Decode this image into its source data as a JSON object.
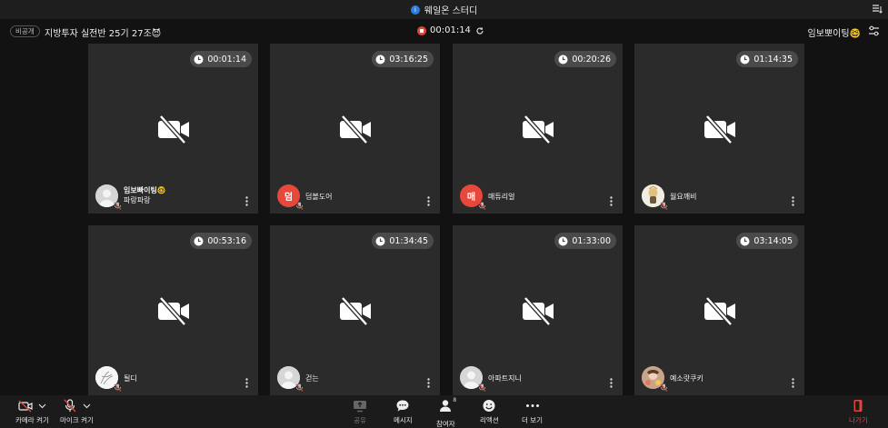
{
  "window": {
    "title": "웨일온 스터디"
  },
  "header": {
    "privacy": "비공개",
    "room_title": "지방투자 실전반 25기 27조😈",
    "elapsed": "00:01:14",
    "me": "임보뽀이팅🤓"
  },
  "participants": [
    {
      "time": "00:01:14",
      "name": "임보빠이팅🤓",
      "subname": "파랑파랑",
      "avatar": {
        "type": "gray",
        "text": ""
      }
    },
    {
      "time": "03:16:25",
      "name": "덤볼도어",
      "avatar": {
        "type": "red",
        "text": "덤"
      }
    },
    {
      "time": "00:20:26",
      "name": "매튜리얼",
      "avatar": {
        "type": "red",
        "text": "매"
      }
    },
    {
      "time": "01:14:35",
      "name": "월요깨비",
      "avatar": {
        "type": "photo",
        "text": ""
      }
    },
    {
      "time": "00:53:16",
      "name": "될디",
      "avatar": {
        "type": "sketch",
        "text": ""
      }
    },
    {
      "time": "01:34:45",
      "name": "걷는",
      "avatar": {
        "type": "gray",
        "text": ""
      }
    },
    {
      "time": "01:33:00",
      "name": "아파트지니",
      "avatar": {
        "type": "gray",
        "text": ""
      }
    },
    {
      "time": "03:14:05",
      "name": "예소랏쿠키",
      "avatar": {
        "type": "photo2",
        "text": ""
      }
    }
  ],
  "controls": {
    "camera": "카메라 켜기",
    "mic": "마이크 켜기",
    "share": "공유",
    "messages": "메시지",
    "participants": "참여자",
    "participant_count": "8",
    "reactions": "리액션",
    "more": "더 보기",
    "leave": "나가기"
  },
  "colors": {
    "accent_red": "#e0453a",
    "avatar_red": "#e8483c",
    "tile": "#2b2b2b"
  }
}
